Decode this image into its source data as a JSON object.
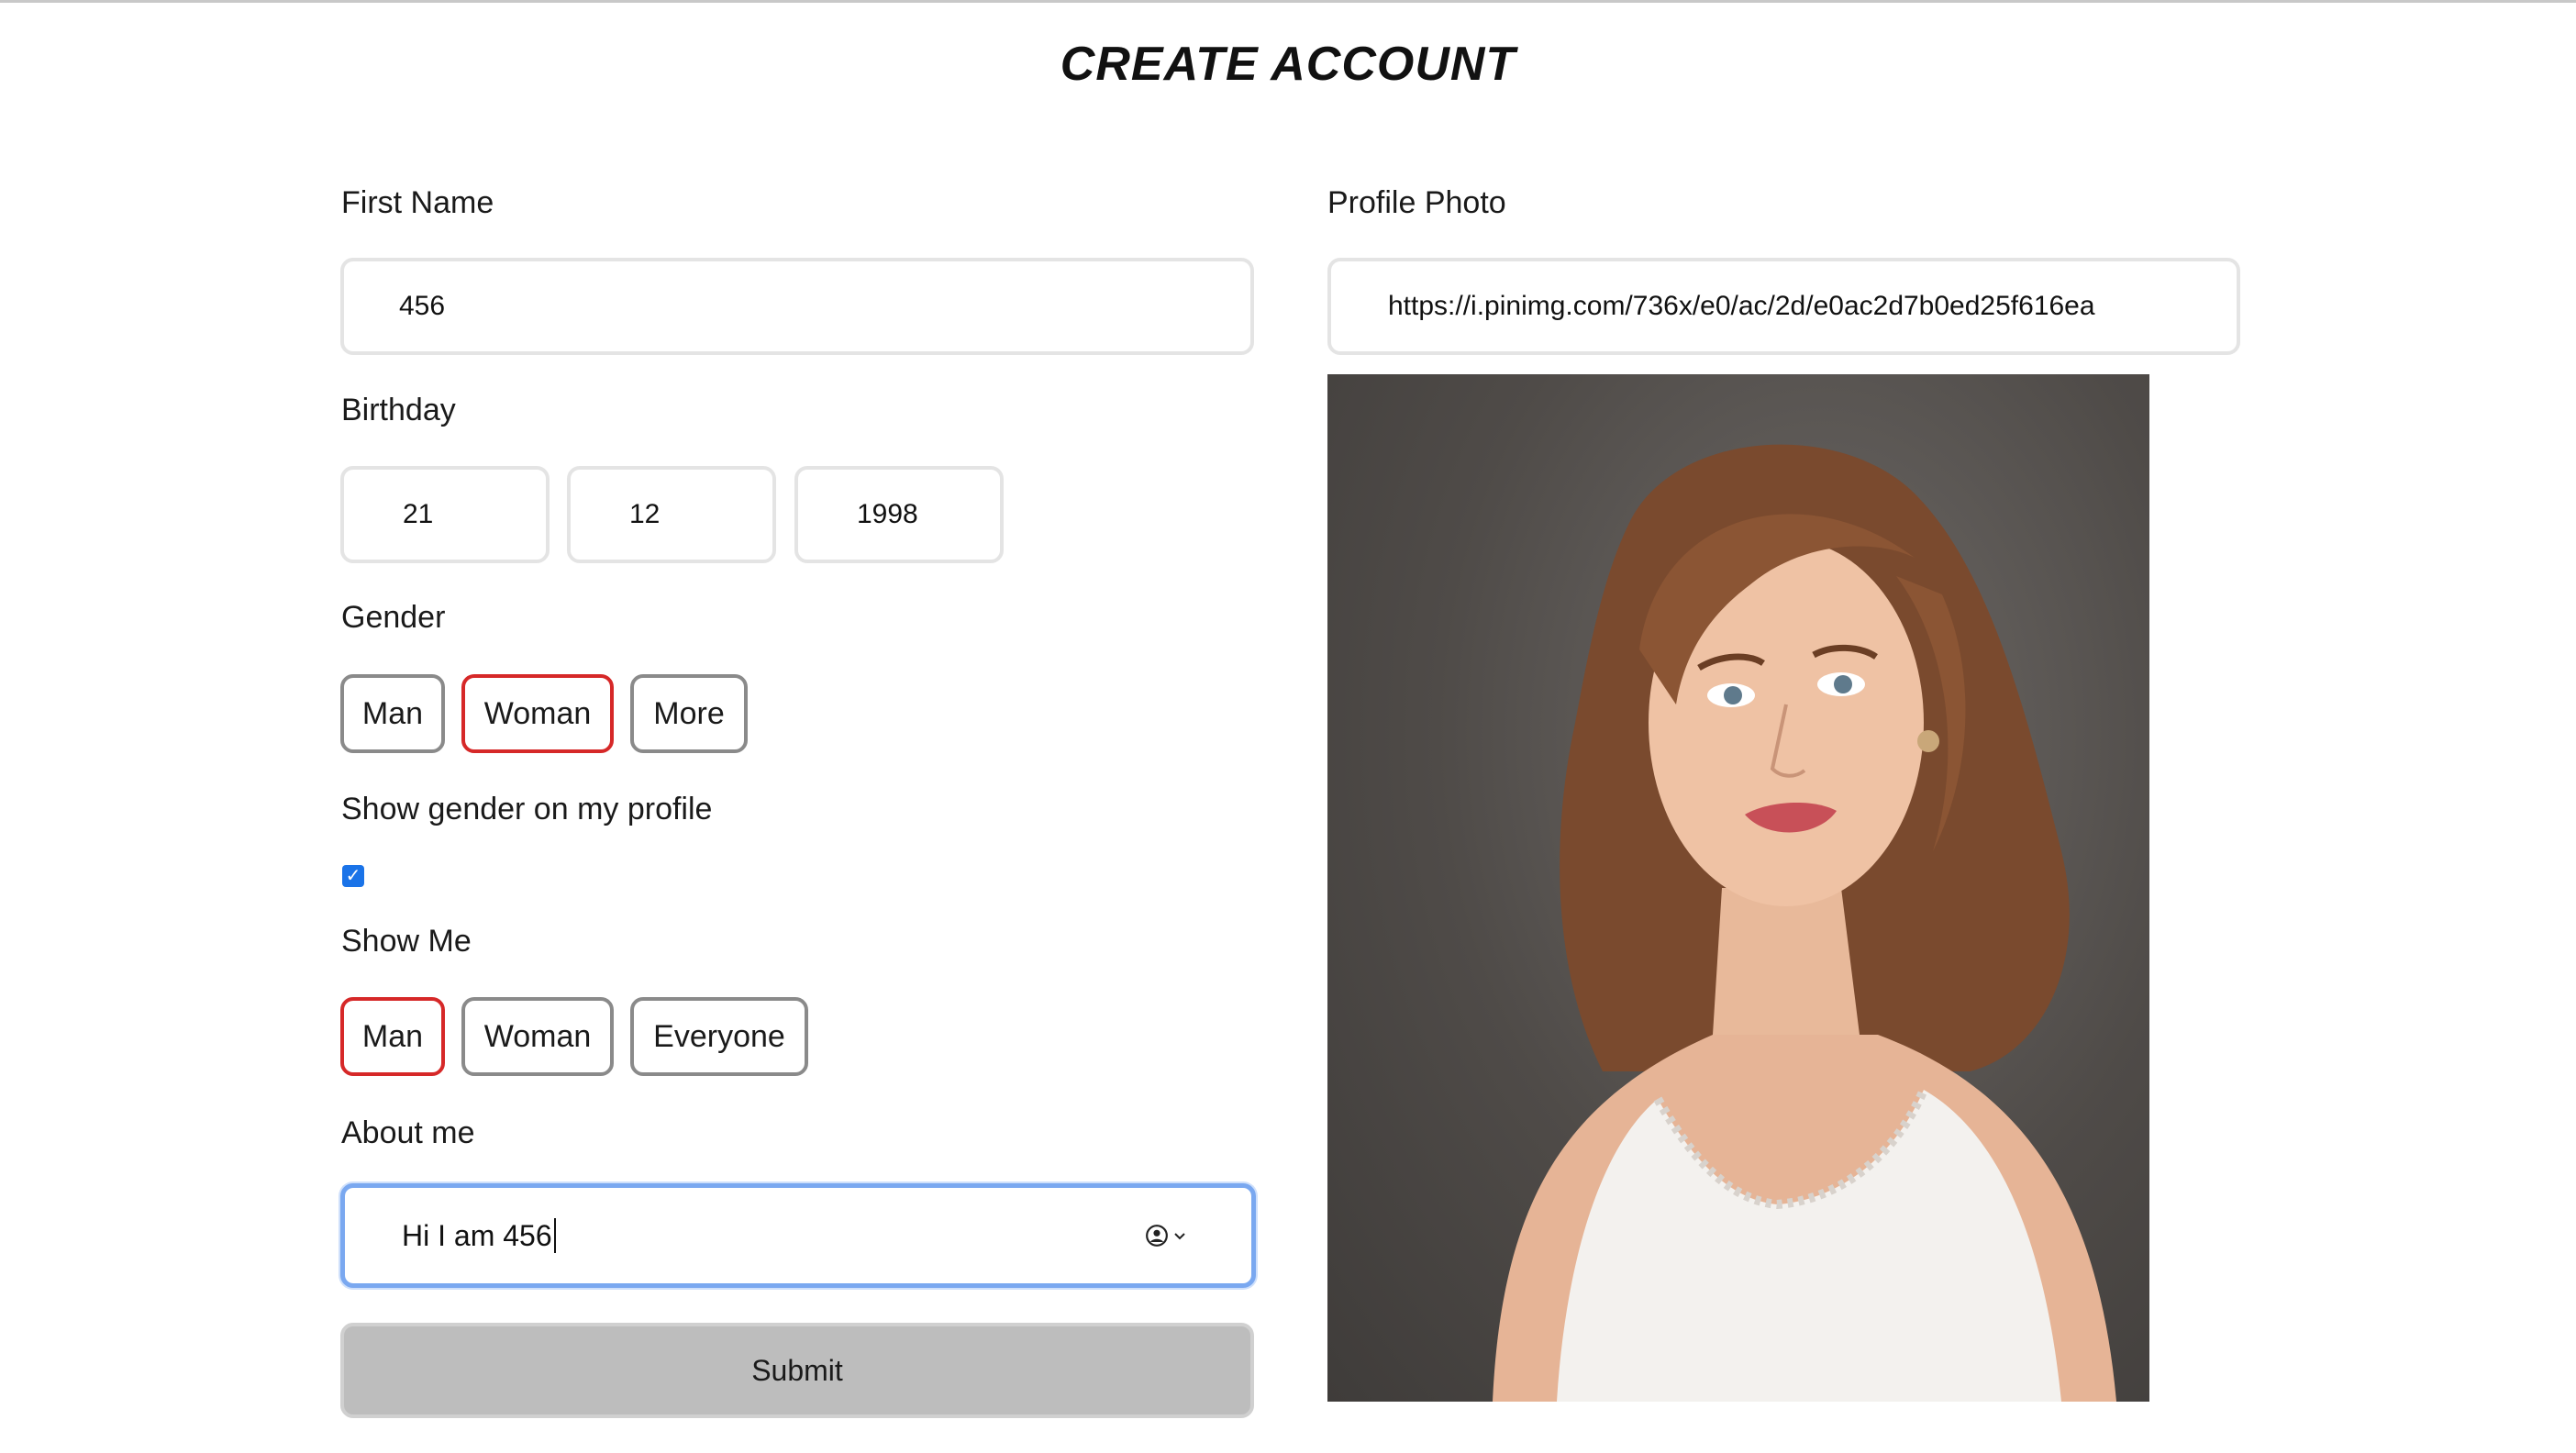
{
  "page": {
    "title": "CREATE ACCOUNT"
  },
  "form": {
    "first_name": {
      "label": "First Name",
      "value": "456"
    },
    "birthday": {
      "label": "Birthday",
      "day": "21",
      "month": "12",
      "year": "1998"
    },
    "gender": {
      "label": "Gender",
      "options": [
        "Man",
        "Woman",
        "More"
      ],
      "selected": "Woman"
    },
    "show_gender": {
      "label": "Show gender on my profile",
      "checked": true
    },
    "show_me": {
      "label": "Show Me",
      "options": [
        "Man",
        "Woman",
        "Everyone"
      ],
      "selected": "Man"
    },
    "about_me": {
      "label": "About me",
      "value": "Hi I am 456"
    },
    "submit_label": "Submit"
  },
  "profile_photo": {
    "label": "Profile Photo",
    "url": "https://i.pinimg.com/736x/e0/ac/2d/e0ac2d7b0ed25f616ea"
  },
  "colors": {
    "selected_border": "#d62828",
    "focus_border": "#7aa8f0",
    "checkbox": "#1a73e8",
    "submit_bg": "#bdbdbd"
  },
  "icons": [
    "account-circle-icon",
    "chevron-down-icon",
    "checkmark-icon"
  ]
}
